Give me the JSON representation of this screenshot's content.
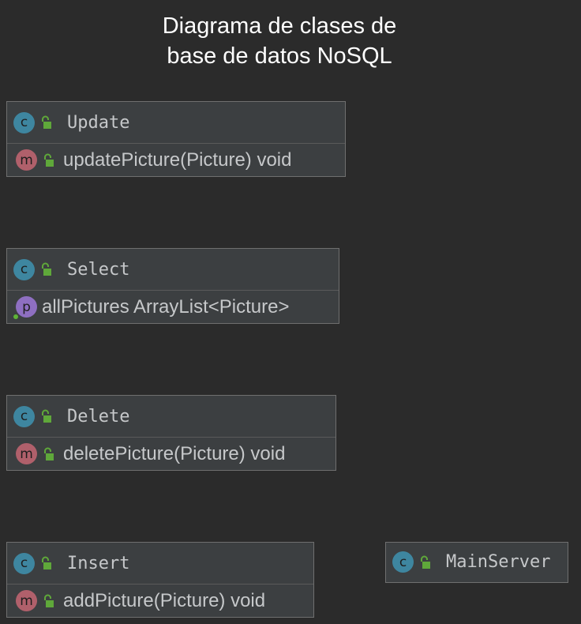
{
  "diagram": {
    "title_line1": "Diagrama de clases de",
    "title_line2": "base de datos NoSQL",
    "badge_class": "c",
    "badge_method": "m",
    "badge_property": "p",
    "colors": {
      "background": "#2b2b2b",
      "box": "#3c3f41",
      "border": "#6f6f6f",
      "text": "#c6c8ca",
      "class_badge": "#3e86a0",
      "method_badge": "#b0606b",
      "property_badge": "#8e6fc1",
      "lock": "#5fa83a"
    },
    "classes": {
      "update": {
        "name": "Update",
        "member": "updatePicture(Picture) void"
      },
      "select": {
        "name": "Select",
        "member": "allPictures ArrayList<Picture>"
      },
      "delete": {
        "name": "Delete",
        "member": "deletePicture(Picture) void"
      },
      "insert": {
        "name": "Insert",
        "member": "addPicture(Picture) void"
      },
      "mainserver": {
        "name": "MainServer"
      }
    }
  }
}
